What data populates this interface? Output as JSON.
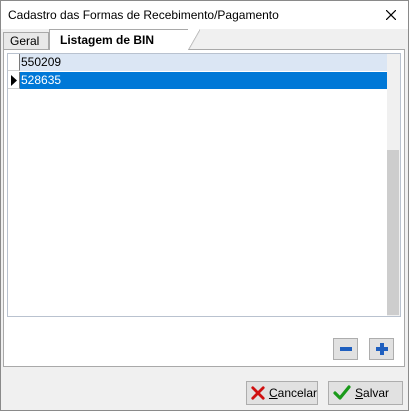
{
  "window": {
    "title": "Cadastro das Formas de Recebimento/Pagamento",
    "close_icon": "close-icon"
  },
  "tabs": [
    {
      "label": "Geral",
      "active": false
    },
    {
      "label": "Listagem de BIN",
      "active": true
    }
  ],
  "grid": {
    "rows": [
      {
        "value": "550209",
        "selected": false
      },
      {
        "value": "528635",
        "selected": true
      }
    ]
  },
  "actions": {
    "remove_icon": "minus-icon",
    "add_icon": "plus-icon"
  },
  "footer": {
    "cancel_first": "C",
    "cancel_rest": "ancelar",
    "save_first": "S",
    "save_rest": "alvar"
  },
  "colors": {
    "selection": "#0078d7",
    "alt_row": "#dbe6f4",
    "plus_minus_blue": "#1f5fbf",
    "cancel_red": "#d01010",
    "save_green": "#1a9a1a"
  }
}
